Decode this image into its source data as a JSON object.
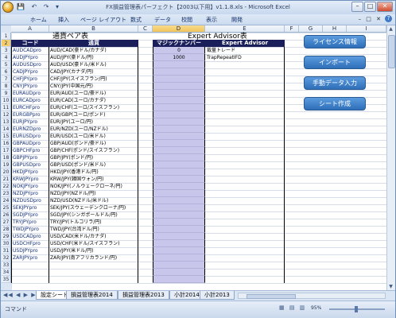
{
  "window": {
    "title": "FX損益管理表パーフェクト【2003以下用】v1.1.8.xls - Microsoft Excel",
    "qat_icons": "💾 ↶ ↷ ▾"
  },
  "ribbon": {
    "tabs": [
      "ホーム",
      "挿入",
      "ページ レイアウト",
      "数式",
      "データ",
      "校閲",
      "表示",
      "開発"
    ]
  },
  "columns": [
    "A",
    "B",
    "C",
    "D",
    "E",
    "F",
    "G",
    "H",
    "I"
  ],
  "selected_column": "D",
  "rows": [
    "1",
    "2",
    "3",
    "4",
    "5",
    "6",
    "7",
    "8",
    "9",
    "10",
    "11",
    "12",
    "13",
    "14",
    "15",
    "16",
    "17",
    "18",
    "19",
    "20",
    "21",
    "22",
    "23",
    "24",
    "25",
    "26",
    "27",
    "28",
    "29",
    "30",
    "31",
    "32",
    "33",
    "34",
    "35"
  ],
  "selected_row": "2",
  "currency_table": {
    "title": "通貨ペア表",
    "header_code": "コード",
    "header_pair": "通貨",
    "items": [
      {
        "code": "AUDCADpro",
        "pair": "AUD/CAD(豪ドル/カナダ)"
      },
      {
        "code": "AUDJPYpro",
        "pair": "AUD/JPY(豪ドル/円)"
      },
      {
        "code": "AUDUSDpro",
        "pair": "AUD/USD(豪ドル/米ドル)"
      },
      {
        "code": "CADJPYpro",
        "pair": "CAD/JPY(カナダ/円)"
      },
      {
        "code": "CHFJPYpro",
        "pair": "CHF/JPY(スイスフラン/円)"
      },
      {
        "code": "CNYJPYpro",
        "pair": "CNY/JPY(中国元/円)"
      },
      {
        "code": "EURAUDpro",
        "pair": "EUR/AUD(ユーロ/豪ドル)"
      },
      {
        "code": "EURCADpro",
        "pair": "EUR/CAD(ユーロ/カナダ)"
      },
      {
        "code": "EURCHFpro",
        "pair": "EUR/CHF(ユーロ/スイスフラン)"
      },
      {
        "code": "EURGBPpro",
        "pair": "EUR/GBP(ユーロ/ポンド)"
      },
      {
        "code": "EURJPYpro",
        "pair": "EUR/JPY(ユーロ/円)"
      },
      {
        "code": "EURNZDpro",
        "pair": "EUR/NZD(ユーロ/NZドル)"
      },
      {
        "code": "EURUSDpro",
        "pair": "EUR/USD(ユーロ/米ドル)"
      },
      {
        "code": "GBPAUDpro",
        "pair": "GBP/AUD(ポンド/豪ドル)"
      },
      {
        "code": "GBPCHFpro",
        "pair": "GBP/CHF(ポンド/スイスフラン)"
      },
      {
        "code": "GBPJPYpro",
        "pair": "GBP/JPY(ポンド/円)"
      },
      {
        "code": "GBPUSDpro",
        "pair": "GBP/USD(ポンド/米ドル)"
      },
      {
        "code": "HKDJPYpro",
        "pair": "HKD/JPY(香港ドル/円)"
      },
      {
        "code": "KRWJPYpro",
        "pair": "KRW/JPY(韓国ウォン/円)"
      },
      {
        "code": "NOKJPYpro",
        "pair": "NOK/JPY(ノルウェークローネ/円)"
      },
      {
        "code": "NZDJPYpro",
        "pair": "NZD/JPY(NZドル/円)"
      },
      {
        "code": "NZDUSDpro",
        "pair": "NZD/USD(NZドル/米ドル)"
      },
      {
        "code": "SEKJPYpro",
        "pair": "SEK/JPY(スウェーデンクローナ/円)"
      },
      {
        "code": "SGDJPYpro",
        "pair": "SGD/JPY(シンガポールドル/円)"
      },
      {
        "code": "TRYJPYpro",
        "pair": "TRY/JPY(トルコリラ/円)"
      },
      {
        "code": "TWDJPYpro",
        "pair": "TWD/JPY(台湾ドル/円)"
      },
      {
        "code": "USDCADpro",
        "pair": "USD/CAD(米ドル/カナダ)"
      },
      {
        "code": "USDCHFpro",
        "pair": "USD/CHF(米ドル/スイスフラン)"
      },
      {
        "code": "USDJPYpro",
        "pair": "USD/JPY(米ドル/円)"
      },
      {
        "code": "ZARJPYpro",
        "pair": "ZAR/JPY(南アフリカランド/円)"
      }
    ]
  },
  "ea_table": {
    "title": "Expert Advisor表",
    "header_magic": "マジックナンバー",
    "header_ea": "Expert Advisor",
    "items": [
      {
        "magic": "0",
        "name": "裁量トレード"
      },
      {
        "magic": "1000",
        "name": "TrapRepeatIFD"
      }
    ]
  },
  "buttons": {
    "license": "ライセンス情報",
    "import": "インポート",
    "manual": "手動データ入力",
    "sheet": "シート作成"
  },
  "sheet_tabs": [
    "設定シート",
    "損益管理表2014",
    "損益管理表2013",
    "小計2014",
    "小計2013"
  ],
  "active_sheet": "設定シート",
  "status": {
    "mode": "コマンド",
    "zoom": "95%"
  },
  "colors": {
    "header_navy": "#1a1f5c",
    "magic_fill": "#c9c6ec",
    "button_blue": "#3f7fc8"
  }
}
